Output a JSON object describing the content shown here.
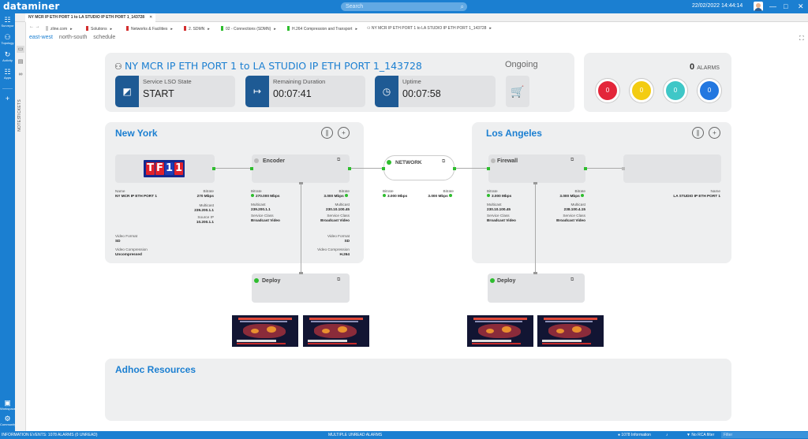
{
  "app": {
    "brand": "dataminer",
    "search_placeholder": "Search",
    "datetime": "22/02/2022 14:44:14"
  },
  "left_bar": {
    "items": [
      {
        "icon": "surveyor-icon",
        "label": "Surveyor"
      },
      {
        "icon": "topology-icon",
        "label": "Topology"
      },
      {
        "icon": "activity-icon",
        "label": "Activity"
      },
      {
        "icon": "apps-icon",
        "label": "Apps"
      },
      {
        "icon": "add-icon",
        "label": ""
      }
    ],
    "bottom": [
      {
        "icon": "workspace-icon",
        "label": "Workspace"
      },
      {
        "icon": "community-icon",
        "label": "Community"
      }
    ]
  },
  "side_panel": {
    "tickets": "TICKETS",
    "notes": "NOTES"
  },
  "tab": {
    "title": "NY MCR IP ETH PORT 1 to LA STUDIO  IP ETH PORT 1_143728"
  },
  "breadcrumbs": [
    {
      "label": "zline.com",
      "color": "#c8c8c8"
    },
    {
      "label": "Solutions",
      "color": "#d32f2f"
    },
    {
      "label": "Networks & Facilities",
      "color": "#d32f2f"
    },
    {
      "label": "2. SDMN",
      "color": "#d32f2f"
    },
    {
      "label": "02 - Connections (SDMN)",
      "color": "#2ebd2e"
    },
    {
      "label": "H.264 Compression and Transport",
      "color": "#2ebd2e"
    },
    {
      "label": "NY MCR IP ETH PORT 1 to LA STUDIO  IP ETH PORT 1_143728",
      "color": ""
    }
  ],
  "sub_tabs": [
    "east-west",
    "north-south",
    "schedule"
  ],
  "service": {
    "title": "NY MCR IP ETH PORT 1 to LA STUDIO  IP ETH PORT 1_143728",
    "state_label": "Service LSO State",
    "state_value": "START",
    "remaining_label": "Remaining Duration",
    "remaining_value": "00:07:41",
    "uptime_label": "Uptime",
    "uptime_value": "00:07:58",
    "status": "Ongoing"
  },
  "alarms": {
    "count": "0",
    "label": "ALARMS",
    "buckets": [
      {
        "value": "0",
        "color": "#e3263a"
      },
      {
        "value": "0",
        "color": "#f3cc12"
      },
      {
        "value": "0",
        "color": "#3fc7c7"
      },
      {
        "value": "0",
        "color": "#2277e0"
      }
    ]
  },
  "new_york": {
    "title": "New York",
    "source": {
      "name_label": "Name",
      "name_value": "NY MCR IP ETH PORT 1",
      "bitrate_label": "Bitrate",
      "bitrate_value": "270 Mbps",
      "multicast_label": "Multicast",
      "multicast_value": "239.200.1.1",
      "sourceip_label": "Source IP",
      "sourceip_value": "10.200.1.1",
      "vformat_label": "Video Format",
      "vformat_value": "SD",
      "vcomp_label": "Video Compression",
      "vcomp_value": "Uncompressed"
    },
    "encoder": {
      "title": "Encoder",
      "in_bitrate_label": "Bitrate",
      "in_bitrate_value": "270.000 Mbps",
      "in_multicast_label": "Multicast",
      "in_multicast_value": "239.200.1.1",
      "out_bitrate_label": "Bitrate",
      "out_bitrate_value": "3.000 Mbps",
      "out_multicast_label": "Multicast",
      "out_multicast_value": "230.10.100.45",
      "out_sc_label": "Service Class",
      "out_sc_value": "Broadcast Video",
      "in_sc_label": "Service Class",
      "in_sc_value": "Broadcast Video",
      "vformat_label": "Video Format",
      "vformat_value": "SD",
      "vcomp_label": "Video Compression",
      "vcomp_value": "H.264"
    },
    "deploy": {
      "title": "Deploy"
    }
  },
  "network": {
    "title": "NETWORK",
    "in_bitrate_label": "Bitrate",
    "in_bitrate_value": "3.000 Mbps",
    "out_bitrate_label": "Bitrate",
    "out_bitrate_value": "3.000 Mbps"
  },
  "los_angeles": {
    "title": "Los Angeles",
    "firewall": {
      "title": "Firewall",
      "in_bitrate_label": "Bitrate",
      "in_bitrate_value": "3.000 Mbps",
      "in_multicast_label": "Multicast",
      "in_multicast_value": "230.10.100.45",
      "in_sc_label": "Service Class",
      "in_sc_value": "Broadcast Video",
      "out_bitrate_label": "Bitrate",
      "out_bitrate_value": "3.000 Mbps",
      "out_multicast_label": "Multicast",
      "out_multicast_value": "238.100.4.15",
      "out_sc_label": "Service Class",
      "out_sc_value": "Broadcast Video"
    },
    "destination": {
      "name_label": "Name",
      "name_value": "LA STUDIO  IP ETH PORT 1"
    },
    "deploy": {
      "title": "Deploy"
    }
  },
  "adhoc": {
    "title": "Adhoc Resources"
  },
  "status_bar": {
    "left": "INFORMATION EVENTS: 1078 ALARMS (0 UNREAD)",
    "center": "MULTIPLE UNREAD ALARMS",
    "info": "1078 Information",
    "rca": "No RCA filter",
    "filter_placeholder": "Filter"
  }
}
